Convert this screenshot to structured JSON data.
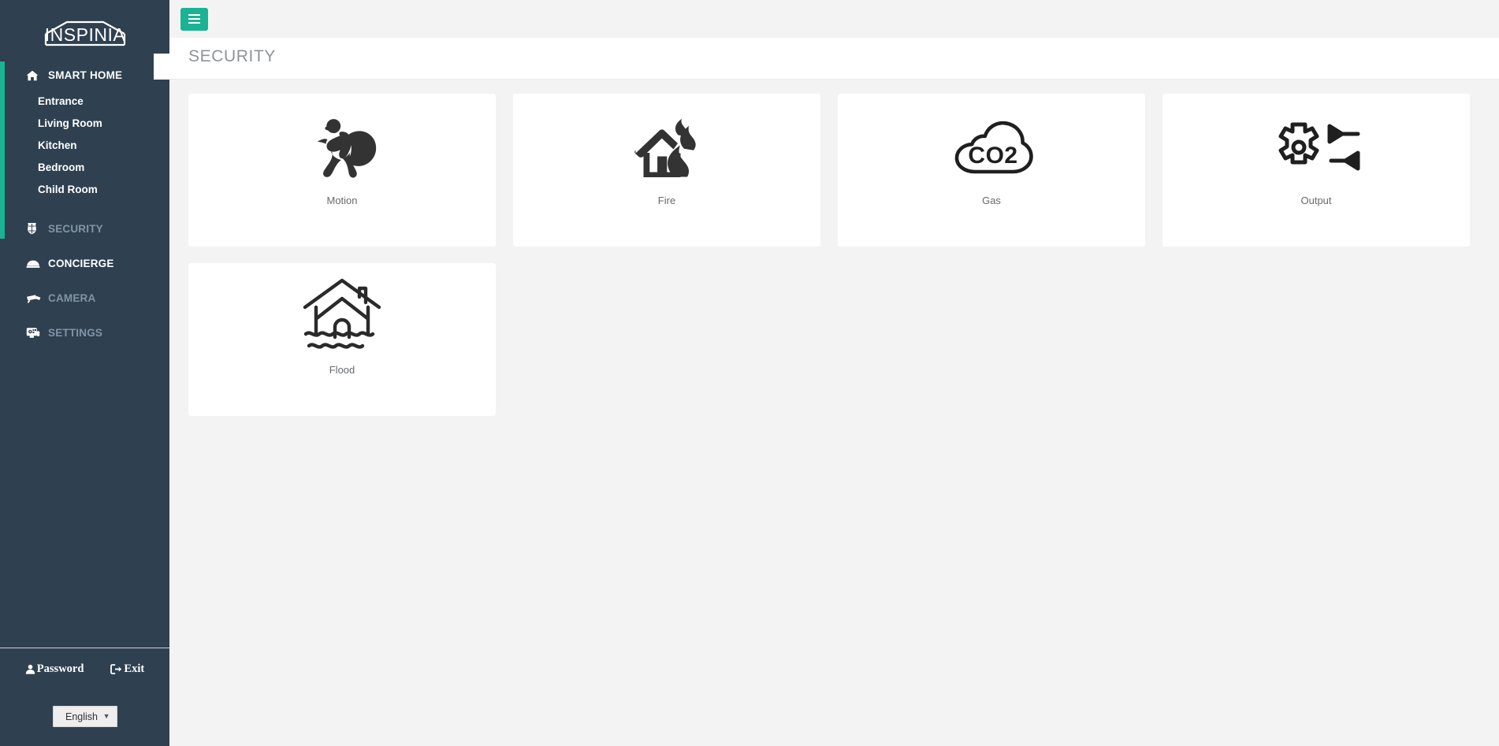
{
  "brand": {
    "logo_text": "INSPINIA"
  },
  "sidebar": {
    "primary": {
      "label": "SMART HOME",
      "icon": "home-icon",
      "caret": "⌄",
      "active": true
    },
    "rooms": [
      {
        "label": "Entrance"
      },
      {
        "label": "Living Room"
      },
      {
        "label": "Kitchen"
      },
      {
        "label": "Bedroom"
      },
      {
        "label": "Child Room"
      }
    ],
    "sections": [
      {
        "label": "SECURITY",
        "icon": "shield-icon",
        "active": true
      },
      {
        "label": "CONCIERGE",
        "icon": "bell-service-icon",
        "active": false
      },
      {
        "label": "CAMERA",
        "icon": "camera-cctv-icon",
        "active": false
      },
      {
        "label": "SETTINGS",
        "icon": "settings-monitor-icon",
        "active": false
      }
    ],
    "bottom_links": [
      {
        "label": "Password",
        "icon": "user-icon"
      },
      {
        "label": "Exit",
        "icon": "sign-out-icon"
      }
    ],
    "language": {
      "value": "English",
      "caret": "▼",
      "options": [
        "English"
      ]
    }
  },
  "topbar": {
    "menu_toggle_label": "",
    "menu_toggle_icon": "hamburger-icon"
  },
  "page": {
    "title": "SECURITY"
  },
  "cards": [
    {
      "label": "Motion",
      "icon": "burglar-icon"
    },
    {
      "label": "Fire",
      "icon": "house-fire-icon"
    },
    {
      "label": "Gas",
      "icon": "co2-cloud-icon"
    },
    {
      "label": "Output",
      "icon": "gear-io-arrows-icon"
    },
    {
      "label": "Flood",
      "icon": "house-flood-icon"
    }
  ],
  "colors": {
    "accent": "#1ab394",
    "sidebar_bg": "#2f4050",
    "content_bg": "#f3f3f4",
    "card_bg": "#ffffff",
    "title_text": "#8d9499",
    "muted_nav_text": "#8095a8"
  }
}
